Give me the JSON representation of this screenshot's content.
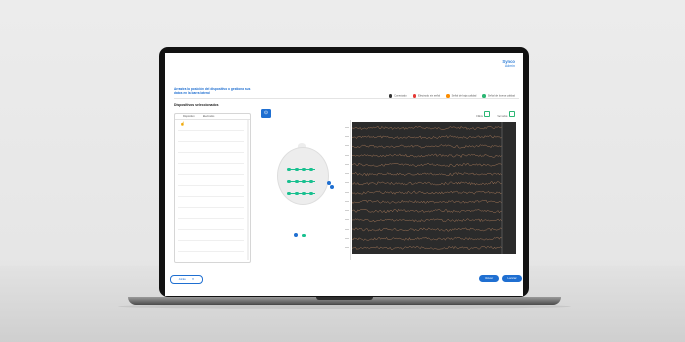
{
  "brand": {
    "name": "Synco",
    "sub": "Admin"
  },
  "instructions": "Arrastra la posición del dispositivo o gestiona sus datos en la barra lateral",
  "legend": [
    {
      "label": "Conectado",
      "color": "#333333"
    },
    {
      "label": "Electrodo sin señal",
      "color": "#e53935"
    },
    {
      "label": "Señal de baja calidad",
      "color": "#fb8c00"
    },
    {
      "label": "Señal de buena calidad",
      "color": "#2bb673"
    }
  ],
  "selected_devices": {
    "title": "Dispositivos seleccionados",
    "columns": [
      "Dispositivo",
      "Electrodos"
    ]
  },
  "toolbar": {
    "left": "Filtros",
    "right": "Ver todos"
  },
  "eeg": {
    "channels": 14
  },
  "footer": {
    "back_label": "Atrás",
    "volver_label": "Volver",
    "lanzar_label": "Lanzar"
  },
  "colors": {
    "accent": "#1f6fd1",
    "electrode": "#18c08f",
    "trace": "#d9986b",
    "eeg_bg": "#2b2b2b"
  }
}
